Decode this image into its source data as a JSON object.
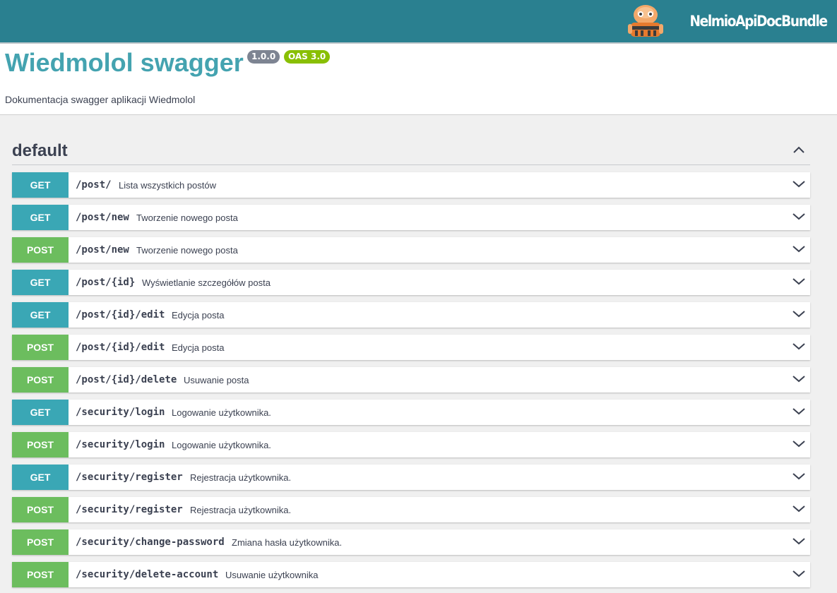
{
  "header": {
    "brand_text": "NelmioApiDocBundle",
    "bar_color": "#2a8090"
  },
  "info": {
    "title": "Wiedmolol swagger",
    "version_badge": "1.0.0",
    "oas_badge": "OAS 3.0",
    "description": "Dokumentacja swagger aplikacji Wiedmolol"
  },
  "tag": {
    "name": "default",
    "expanded": true
  },
  "method_colors": {
    "GET": "#3aa7b5",
    "POST": "#6cbd5e"
  },
  "operations": [
    {
      "method": "GET",
      "path": "/post/",
      "summary": "Lista wszystkich postów"
    },
    {
      "method": "GET",
      "path": "/post/new",
      "summary": "Tworzenie nowego posta"
    },
    {
      "method": "POST",
      "path": "/post/new",
      "summary": "Tworzenie nowego posta"
    },
    {
      "method": "GET",
      "path": "/post/{id}",
      "summary": "Wyświetlanie szczegółów posta"
    },
    {
      "method": "GET",
      "path": "/post/{id}/edit",
      "summary": "Edycja posta"
    },
    {
      "method": "POST",
      "path": "/post/{id}/edit",
      "summary": "Edycja posta"
    },
    {
      "method": "POST",
      "path": "/post/{id}/delete",
      "summary": "Usuwanie posta"
    },
    {
      "method": "GET",
      "path": "/security/login",
      "summary": "Logowanie użytkownika."
    },
    {
      "method": "POST",
      "path": "/security/login",
      "summary": "Logowanie użytkownika."
    },
    {
      "method": "GET",
      "path": "/security/register",
      "summary": "Rejestracja użytkownika."
    },
    {
      "method": "POST",
      "path": "/security/register",
      "summary": "Rejestracja użytkownika."
    },
    {
      "method": "POST",
      "path": "/security/change-password",
      "summary": "Zmiana hasła użytkownika."
    },
    {
      "method": "POST",
      "path": "/security/delete-account",
      "summary": "Usuwanie użytkownika"
    }
  ]
}
